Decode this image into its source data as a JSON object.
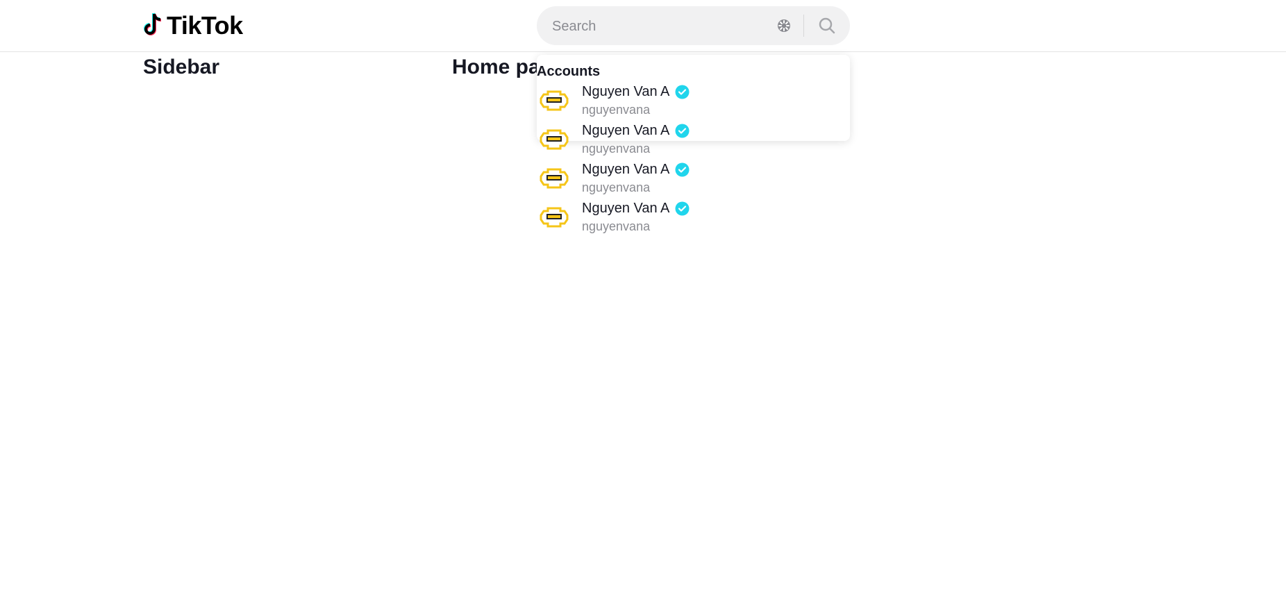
{
  "header": {
    "logo_text": "TikTok",
    "search": {
      "placeholder": "Search",
      "value": ""
    }
  },
  "main": {
    "sidebar_title": "Sidebar",
    "home_title": "Home pa"
  },
  "search_results": {
    "section_label": "Accounts",
    "accounts": [
      {
        "name": "Nguyen Van A",
        "username": "nguyenvana",
        "verified": true
      },
      {
        "name": "Nguyen Van A",
        "username": "nguyenvana",
        "verified": true
      },
      {
        "name": "Nguyen Van A",
        "username": "nguyenvana",
        "verified": true
      },
      {
        "name": "Nguyen Van A",
        "username": "nguyenvana",
        "verified": true
      }
    ]
  },
  "colors": {
    "verified": "#20d5ec",
    "avatar_accent": "#f5c518",
    "logo_cyan": "#25f4ee",
    "logo_red": "#fe2c55"
  },
  "icons": {
    "logo": "tiktok-note-icon",
    "clear": "loading-clear-icon",
    "search": "search-icon",
    "verified": "verified-check-icon",
    "avatar": "avatar-image"
  }
}
